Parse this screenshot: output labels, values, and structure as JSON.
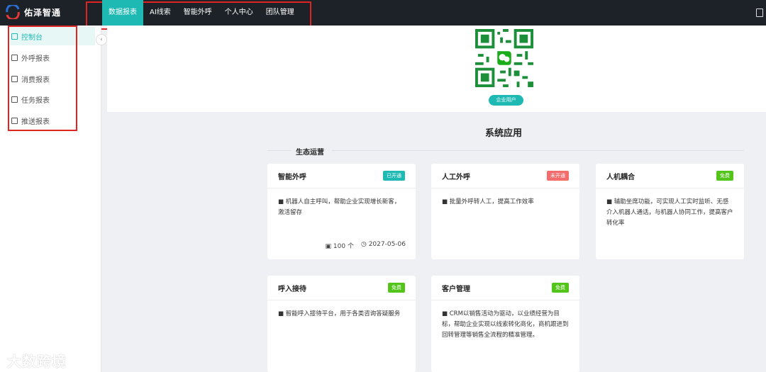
{
  "brand": {
    "name": "佑泽智通"
  },
  "nav": {
    "items": [
      {
        "label": "数据报表",
        "active": true
      },
      {
        "label": "AI线索",
        "active": false
      },
      {
        "label": "智能外呼",
        "active": false
      },
      {
        "label": "个人中心",
        "active": false
      },
      {
        "label": "团队管理",
        "active": false
      }
    ]
  },
  "sidebar": {
    "items": [
      {
        "label": "控制台",
        "icon": "dashboard-icon",
        "active": true
      },
      {
        "label": "外呼报表",
        "icon": "chart-icon"
      },
      {
        "label": "消费报表",
        "icon": "wallet-icon"
      },
      {
        "label": "任务报表",
        "icon": "task-icon"
      },
      {
        "label": "推送报表",
        "icon": "send-icon"
      }
    ]
  },
  "qr": {
    "badge": "企业用户"
  },
  "section": {
    "title": "系统应用",
    "subtitle": "生态运营"
  },
  "cards": [
    {
      "title": "智能外呼",
      "status": "已开通",
      "status_color": "#1fb9b4",
      "desc": "■ 机器人自主呼叫，帮助企业实现增长新客，激活留存",
      "count": "100 个",
      "date": "2027-05-06"
    },
    {
      "title": "人工外呼",
      "status": "未开通",
      "status_color": "#f56c6c",
      "desc": "■ 批量外呼转人工，提高工作效率"
    },
    {
      "title": "人机耦合",
      "status": "免费",
      "status_color": "#52c41a",
      "desc": "■ 辅助坐席功能，可实现人工实时监听、无感介入机器人通话，与机器人协同工作，提高客户转化率"
    },
    {
      "title": "呼入接待",
      "status": "免费",
      "status_color": "#52c41a",
      "desc": "■ 智能呼入接待平台，用于各类咨询答疑服务"
    },
    {
      "title": "客户管理",
      "status": "免费",
      "status_color": "#52c41a",
      "desc": "■ CRM以销售活动为驱动，以业绩经营为目标，帮助企业实现以线索转化商化，商机跟进到回转管理等销售全流程的精准管理。"
    }
  ],
  "watermark": "大数跨境"
}
